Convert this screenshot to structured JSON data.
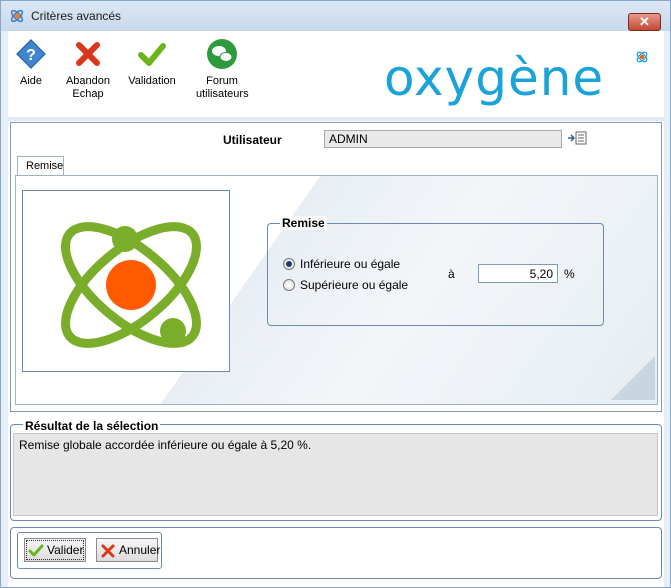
{
  "window": {
    "title": "Critères avancés",
    "close_glyph": "✕"
  },
  "toolbar": {
    "items": [
      {
        "label": "Aide",
        "icon": "help-icon"
      },
      {
        "label": "Abandon",
        "label2": "Echap",
        "icon": "cancel-icon"
      },
      {
        "label": "Validation",
        "icon": "checkmark-icon"
      },
      {
        "label": "Forum",
        "label2": "utilisateurs",
        "icon": "forum-icon"
      }
    ],
    "logo_text": "oxygène"
  },
  "user": {
    "label": "Utilisateur",
    "value": "ADMIN"
  },
  "tabs": [
    {
      "label": "Remise"
    }
  ],
  "remise": {
    "group_title": "Remise",
    "options": [
      {
        "label": "Inférieure ou égale",
        "selected": true
      },
      {
        "label": "Supérieure ou égale",
        "selected": false
      }
    ],
    "a_label": "à",
    "value": "5,20",
    "unit": "%"
  },
  "result": {
    "title": "Résultat de la sélection",
    "text": "Remise globale accordée inférieure ou égale à 5,20 %."
  },
  "buttons": {
    "valider": "Valider",
    "annuler": "Annuler"
  },
  "colors": {
    "logo_blue": "#1aa3d9",
    "atom_green": "#7aae2a",
    "atom_orange": "#ff5a00",
    "cancel_red": "#d9361a"
  }
}
